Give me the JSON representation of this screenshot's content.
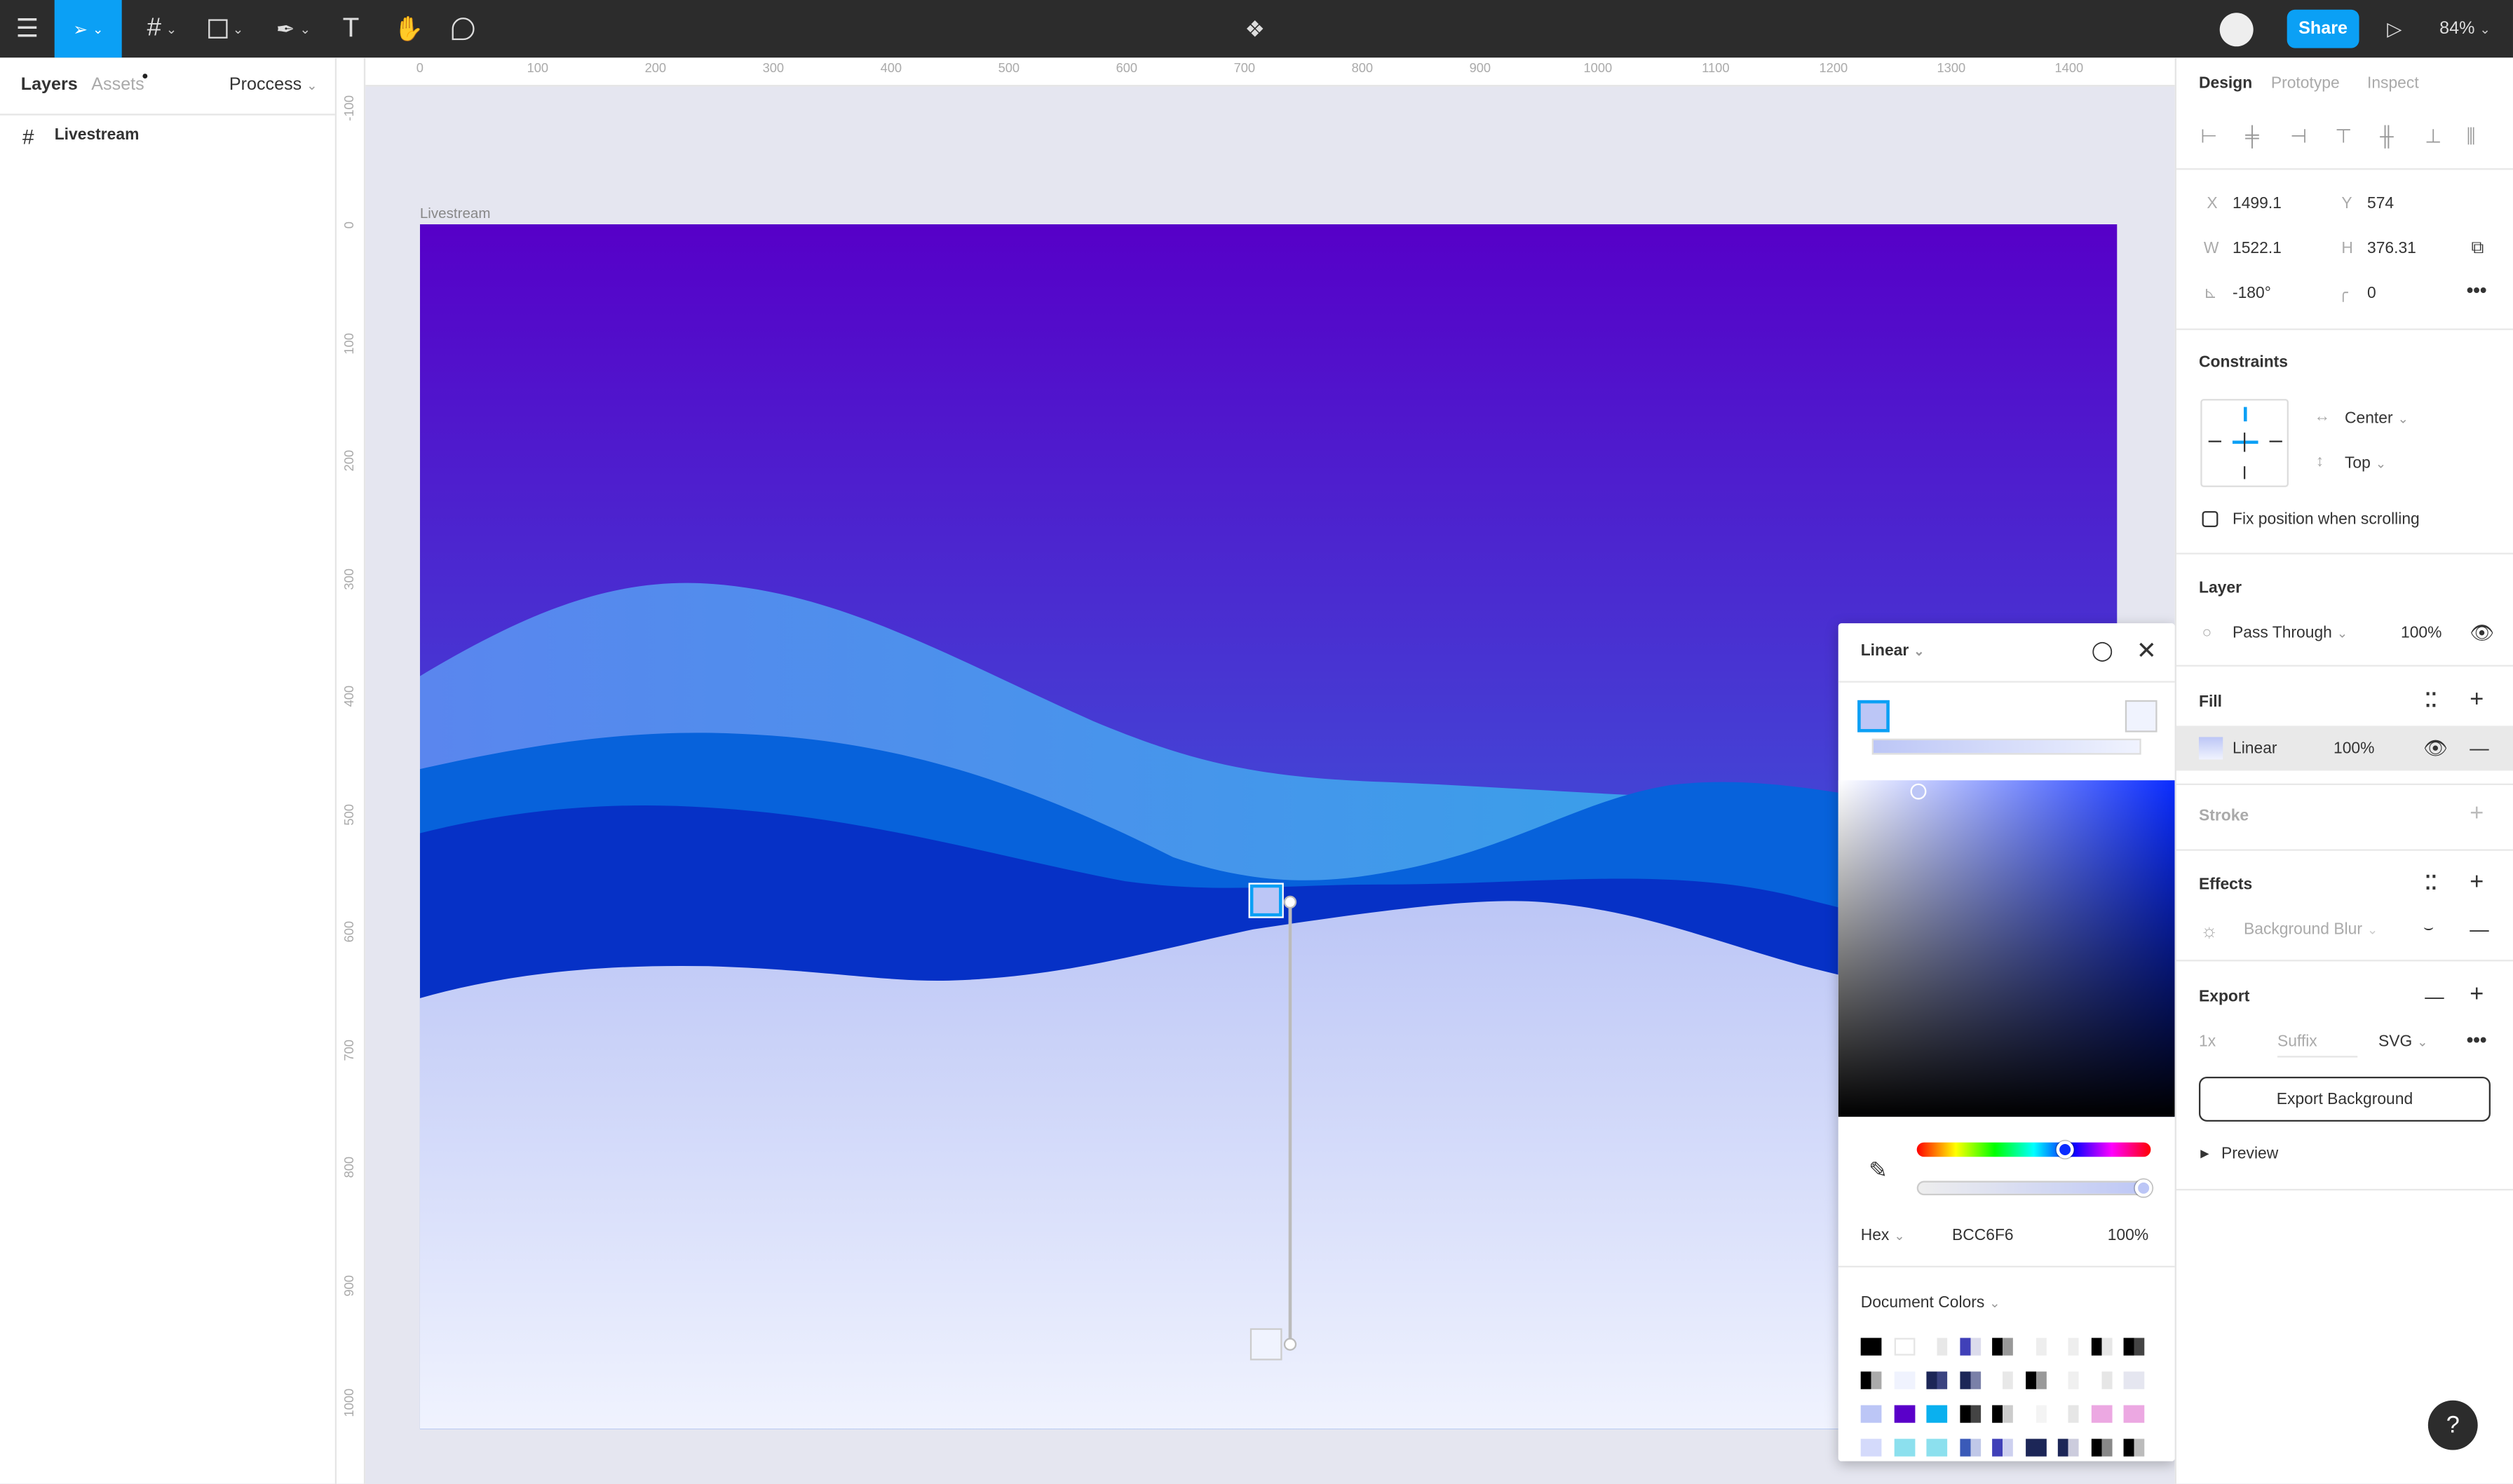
{
  "toolbar": {
    "menu_icon": "hamburger-icon",
    "tools": [
      "move-tool",
      "frame-tool",
      "shape-tool",
      "pen-tool",
      "text-tool",
      "hand-tool",
      "comment-tool"
    ],
    "share_label": "Share",
    "zoom": "84%",
    "accent": "#0ba0f5"
  },
  "left_panel": {
    "tabs": [
      "Layers",
      "Assets"
    ],
    "page": "Proccess",
    "layers": [
      {
        "name": "Livestream",
        "icon": "frame-icon"
      }
    ]
  },
  "canvas": {
    "frame_label": "Livestream",
    "ruler_x": [
      "0",
      "100",
      "200",
      "300",
      "400",
      "500",
      "600",
      "700",
      "800",
      "900",
      "1000",
      "1100",
      "1200",
      "1300",
      "1400"
    ],
    "ruler_y": [
      "-100",
      "0",
      "100",
      "200",
      "300",
      "400",
      "500",
      "600",
      "700",
      "800",
      "900",
      "1000"
    ]
  },
  "right_panel": {
    "tabs": [
      "Design",
      "Prototype",
      "Inspect"
    ],
    "x_label": "X",
    "x": "1499.1",
    "y_label": "Y",
    "y": "574",
    "w_label": "W",
    "w": "1522.1",
    "h_label": "H",
    "h": "376.31",
    "rotation": "-180°",
    "radius": "0",
    "constraints": {
      "title": "Constraints",
      "horizontal": "Center",
      "vertical": "Top",
      "fix_label": "Fix position when scrolling",
      "fix_checked": false
    },
    "layer": {
      "title": "Layer",
      "blend": "Pass Through",
      "opacity": "100%"
    },
    "fill": {
      "title": "Fill",
      "type": "Linear",
      "opacity": "100%",
      "swatch": "#bcc6f6"
    },
    "stroke": {
      "title": "Stroke"
    },
    "effects": {
      "title": "Effects",
      "effect": "Background Blur"
    },
    "export": {
      "title": "Export",
      "scale": "1x",
      "suffix_placeholder": "Suffix",
      "format": "SVG",
      "button": "Export Background",
      "preview": "Preview"
    }
  },
  "picker": {
    "type": "Linear",
    "stop_start": "#bcc6f6",
    "stop_end": "#f0f3fe",
    "mode": "Hex",
    "hex": "BCC6F6",
    "opacity": "100%",
    "hue_fraction": 0.63,
    "doc_colors_label": "Document Colors",
    "doc_colors": [
      [
        "#000000",
        "#ffffff",
        "#ffffff|#e8e8e8",
        "#4040b8|#dcdcec",
        "#000000|#999999",
        "#ffffff|#eeeeee",
        "#ffffff|#eeeeee",
        "#000000|#e6e6e6",
        "#000000|#444444"
      ],
      [
        "#000000|#aaaaaa",
        "#f0f3fe",
        "#1c2657|#3a4380",
        "#1c2657|#7a80a8",
        "#ffffff|#e8e8e8",
        "#000000|#999999",
        "#ffffff|#f0f0f0",
        "#ffffff|#e6e6e6",
        "#e5e6f0"
      ],
      [
        "#bcc6f6",
        "#5a00c9",
        "#0ab0ef",
        "#000000|#444444",
        "#000000|#cccccc",
        "#ffffff|#f4f4f4",
        "#ffffff|#e6e6e6",
        "#eca8e2",
        "#eca8e2"
      ],
      [
        "#d4dafb",
        "#8ce0ee",
        "#8ce0ee",
        "#3a5ab8|#c0c8e8",
        "#4040b8|#cdd0ef",
        "#1c2657",
        "#1c2657|#ccccdd",
        "#000000|#888888",
        "#000000|#bbbbbb"
      ]
    ]
  },
  "help_label": "?"
}
